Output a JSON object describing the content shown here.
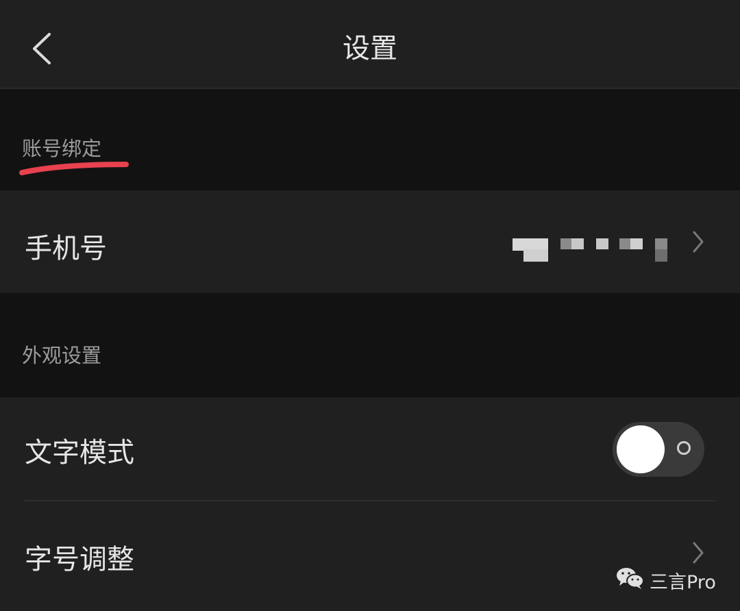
{
  "header": {
    "title": "设置",
    "back_icon": "chevron-left-icon"
  },
  "sections": {
    "account": {
      "label": "账号绑定",
      "highlight_color": "#e8414f"
    },
    "appearance": {
      "label": "外观设置"
    }
  },
  "rows": {
    "phone": {
      "label": "手机号",
      "value_icon": "pixelated-redacted-value",
      "chevron_icon": "chevron-right-icon"
    },
    "text_mode": {
      "label": "文字模式",
      "toggle_on": false
    },
    "font_size": {
      "label": "字号调整",
      "chevron_icon": "chevron-right-icon"
    }
  },
  "watermark": {
    "text": "三言Pro",
    "icon": "wechat-icon"
  }
}
